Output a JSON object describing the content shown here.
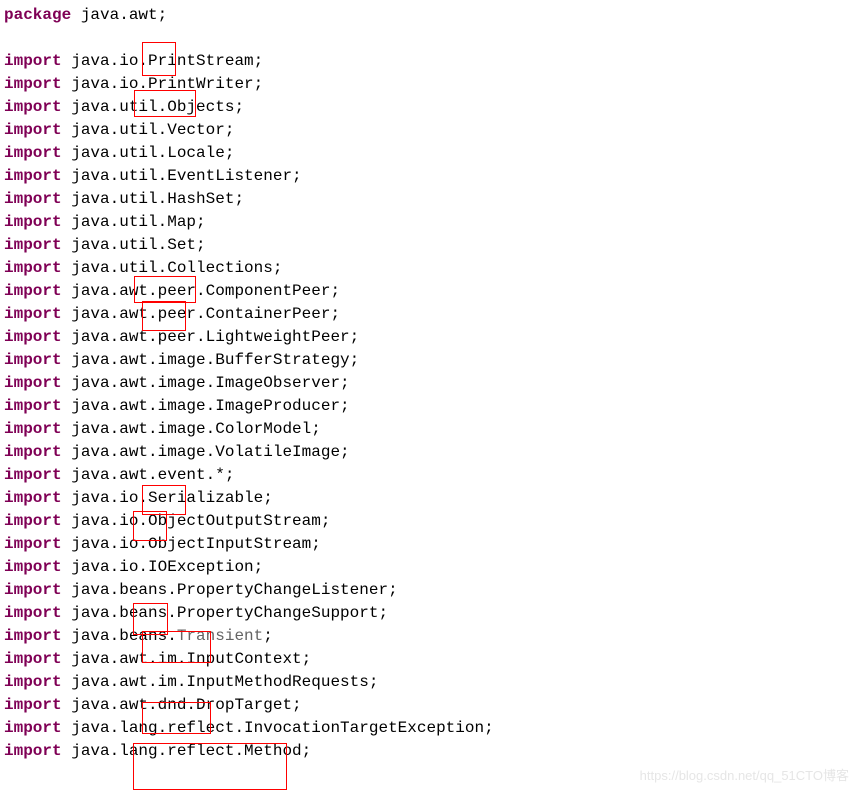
{
  "code": {
    "package_kw": "package",
    "package_name": " java.awt;",
    "import_kw": "import",
    "lines": [
      " java.io.PrintStream;",
      " java.io.PrintWriter;",
      " java.util.Objects;",
      " java.util.Vector;",
      " java.util.Locale;",
      " java.util.EventListener;",
      " java.util.HashSet;",
      " java.util.Map;",
      " java.util.Set;",
      " java.util.Collections;",
      " java.awt.peer.ComponentPeer;",
      " java.awt.peer.ContainerPeer;",
      " java.awt.peer.LightweightPeer;",
      " java.awt.image.BufferStrategy;",
      " java.awt.image.ImageObserver;",
      " java.awt.image.ImageProducer;",
      " java.awt.image.ColorModel;",
      " java.awt.image.VolatileImage;",
      " java.awt.event.*;",
      " java.io.Serializable;",
      " java.io.ObjectOutputStream;",
      " java.io.ObjectInputStream;",
      " java.io.IOException;",
      " java.beans.PropertyChangeListener;",
      " java.beans.PropertyChangeSupport;",
      " java.beans.",
      " java.awt.im.InputContext;",
      " java.awt.im.InputMethodRequests;",
      " java.awt.dnd.DropTarget;",
      " java.lang.reflect.InvocationTargetException;",
      " java.lang.reflect.Method;"
    ],
    "transient_ann": "Transient",
    "semicolon": ";"
  },
  "watermark": "https://blog.csdn.net/qq_51CTO博客"
}
